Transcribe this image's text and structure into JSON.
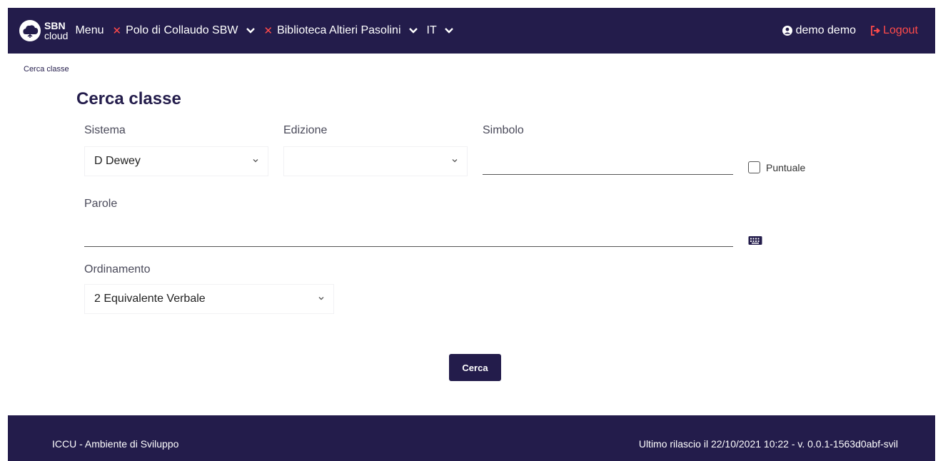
{
  "header": {
    "logo_top": "SBN",
    "logo_bottom": "cloud",
    "menu_label": "Menu",
    "polo_label": "Polo di Collaudo SBW",
    "biblioteca_label": "Biblioteca Altieri Pasolini",
    "language_label": "IT",
    "user_label": "demo demo",
    "logout_label": "Logout"
  },
  "breadcrumb": "Cerca classe",
  "page_title": "Cerca classe",
  "form": {
    "sistema_label": "Sistema",
    "sistema_value": "D Dewey",
    "edizione_label": "Edizione",
    "edizione_value": "",
    "simbolo_label": "Simbolo",
    "simbolo_value": "",
    "puntuale_label": "Puntuale",
    "parole_label": "Parole",
    "parole_value": "",
    "ordinamento_label": "Ordinamento",
    "ordinamento_value": "2 Equivalente Verbale",
    "search_button": "Cerca"
  },
  "footer": {
    "left_text": "ICCU - Ambiente di Sviluppo",
    "right_text": "Ultimo rilascio il 22/10/2021 10:22 - v. 0.0.1-1563d0abf-svil"
  },
  "colors": {
    "primary": "#231c4b",
    "accent_red": "#ff4a4a"
  }
}
